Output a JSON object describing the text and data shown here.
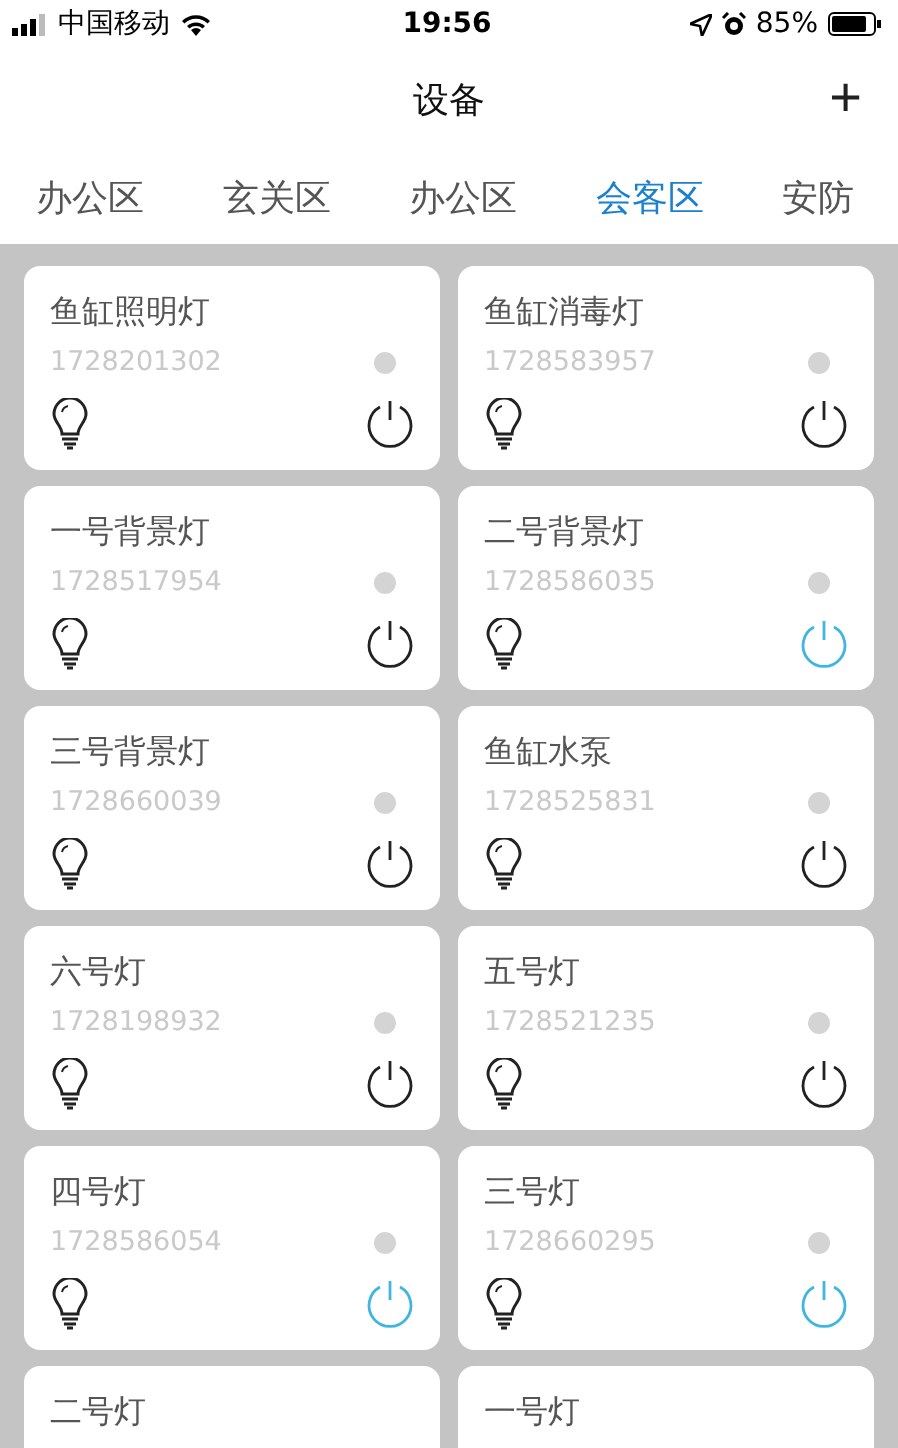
{
  "status_bar": {
    "carrier": "中国移动",
    "time": "19:56",
    "battery": "85%"
  },
  "header": {
    "title": "设备",
    "add": "+"
  },
  "tabs": [
    {
      "label": "办公区",
      "selected": false
    },
    {
      "label": "玄关区",
      "selected": false
    },
    {
      "label": "办公区",
      "selected": false
    },
    {
      "label": "会客区",
      "selected": true
    },
    {
      "label": "安防",
      "selected": false
    }
  ],
  "devices": [
    {
      "name": "鱼缸照明灯",
      "id": "1728201302",
      "on": false
    },
    {
      "name": "鱼缸消毒灯",
      "id": "1728583957",
      "on": false
    },
    {
      "name": "一号背景灯",
      "id": "1728517954",
      "on": false
    },
    {
      "name": "二号背景灯",
      "id": "1728586035",
      "on": true
    },
    {
      "name": "三号背景灯",
      "id": "1728660039",
      "on": false
    },
    {
      "name": "鱼缸水泵",
      "id": "1728525831",
      "on": false
    },
    {
      "name": "六号灯",
      "id": "1728198932",
      "on": false
    },
    {
      "name": "五号灯",
      "id": "1728521235",
      "on": false
    },
    {
      "name": "四号灯",
      "id": "1728586054",
      "on": true
    },
    {
      "name": "三号灯",
      "id": "1728660295",
      "on": true
    },
    {
      "name": "二号灯"
    },
    {
      "name": "一号灯"
    }
  ]
}
